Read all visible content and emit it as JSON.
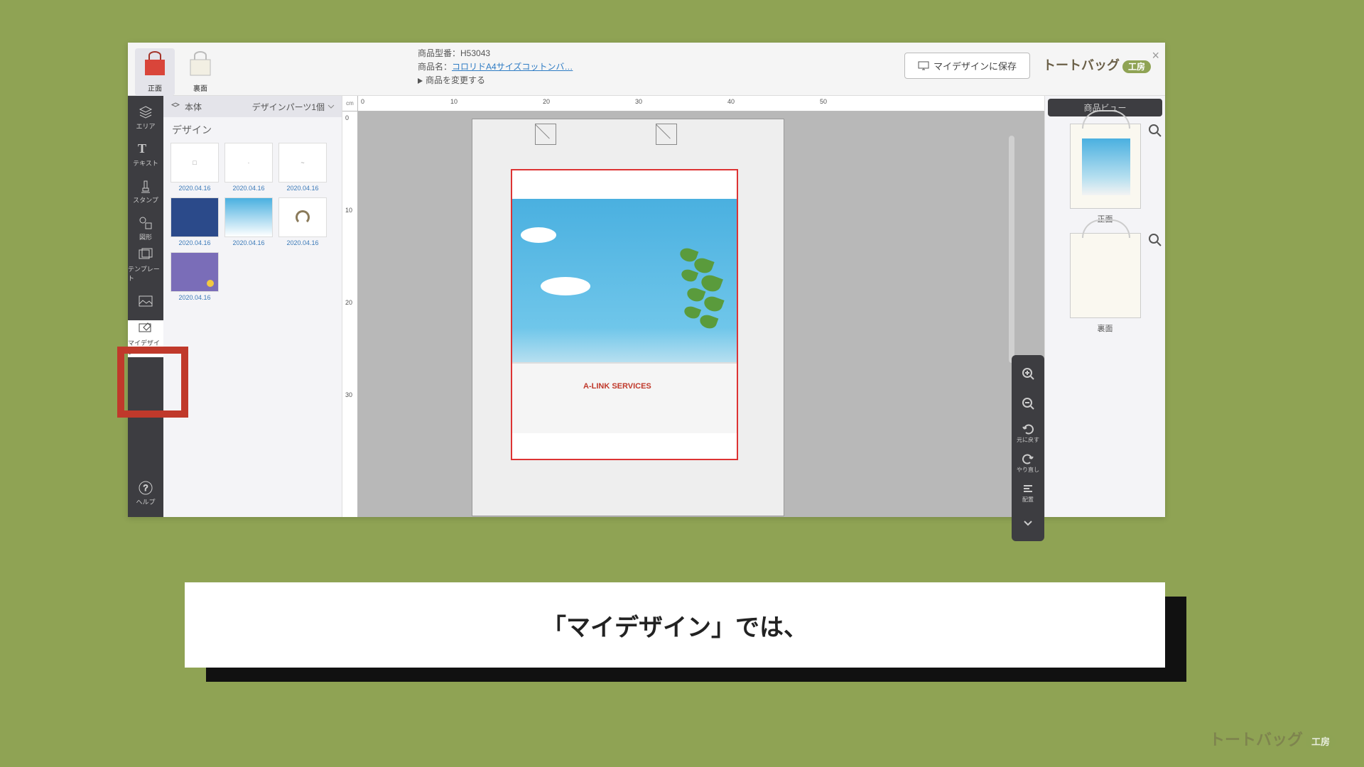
{
  "header": {
    "front_label": "正面",
    "back_label": "裏面",
    "model_label": "商品型番：",
    "model_value": "H53043",
    "name_label": "商品名：",
    "name_link": "コロリドA4サイズコットンバ…",
    "change_product": "商品を変更する",
    "save_btn": "マイデザインに保存",
    "brand": "トートバッグ",
    "brand_badge": "工房"
  },
  "tools": {
    "area": "エリア",
    "text": "テキスト",
    "stamp": "スタンプ",
    "shape": "図形",
    "template": "テンプレート",
    "image": "",
    "mydesign": "マイデザイン",
    "help": "ヘルプ"
  },
  "panel": {
    "area_name": "本体",
    "parts_count": "デザインパーツ1個",
    "section_title": "デザイン",
    "thumbs": [
      {
        "date": "2020.04.16"
      },
      {
        "date": "2020.04.16"
      },
      {
        "date": "2020.04.16"
      },
      {
        "date": "2020.04.16"
      },
      {
        "date": "2020.04.16"
      },
      {
        "date": "2020.04.16"
      },
      {
        "date": "2020.04.16"
      }
    ]
  },
  "ruler": {
    "unit": "cm",
    "h": [
      "0",
      "10",
      "20",
      "30",
      "40",
      "50"
    ],
    "v": [
      "0",
      "10",
      "20",
      "30"
    ]
  },
  "canvas": {
    "building_text": "A-LINK SERVICES"
  },
  "rtools": {
    "undo": "元に戻す",
    "redo": "やり直し",
    "align": "配置"
  },
  "preview": {
    "title": "商品ビュー",
    "front": "正面",
    "back": "裏面"
  },
  "caption": "「マイデザイン」では、",
  "watermark": {
    "brand": "トートバッグ",
    "badge": "工房"
  }
}
